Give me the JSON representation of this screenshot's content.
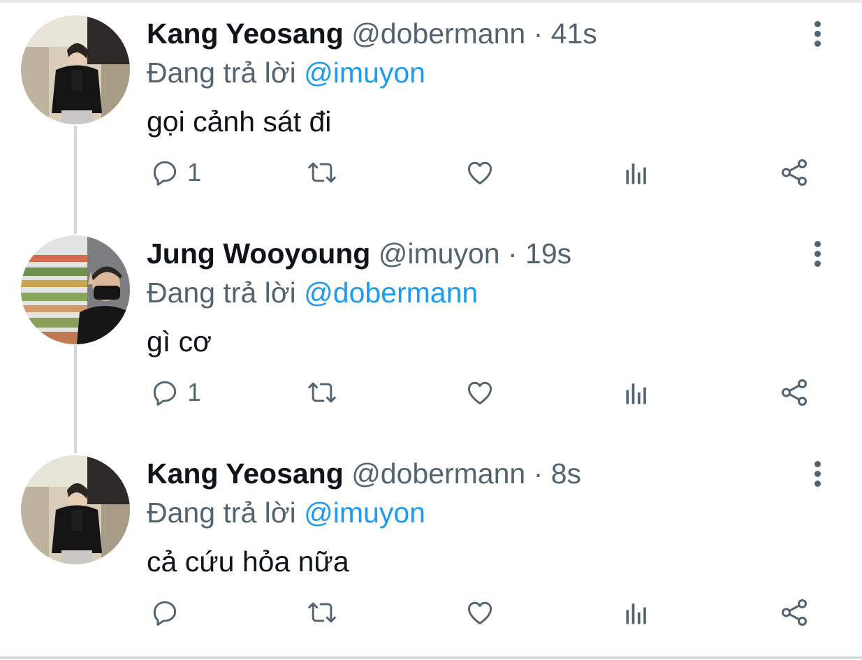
{
  "tweets": [
    {
      "name": "Kang Yeosang",
      "handle": "@dobermann",
      "separator": "·",
      "time": "41s",
      "replying_prefix": "Đang trả lời",
      "replying_to": "@imuyon",
      "text": "gọi cảnh sát đi",
      "reply_count": "1",
      "avatar": "profile-photo-man-black-shirt"
    },
    {
      "name": "Jung Wooyoung",
      "handle": "@imuyon",
      "separator": "·",
      "time": "19s",
      "replying_prefix": "Đang trả lời",
      "replying_to": "@dobermann",
      "text": "gì cơ",
      "reply_count": "1",
      "avatar": "profile-photo-man-mask-store"
    },
    {
      "name": "Kang Yeosang",
      "handle": "@dobermann",
      "separator": "·",
      "time": "8s",
      "replying_prefix": "Đang trả lời",
      "replying_to": "@imuyon",
      "text": "cả cứu hỏa nữa",
      "reply_count": "",
      "avatar": "profile-photo-man-black-shirt"
    }
  ],
  "icons": {
    "reply": "reply-icon",
    "retweet": "retweet-icon",
    "like": "heart-icon",
    "analytics": "analytics-icon",
    "share": "share-icon",
    "more": "more-vertical-icon"
  },
  "colors": {
    "link": "#1d9bf0",
    "secondary": "#536471",
    "primary_text": "#0f1419",
    "thread_line": "#cfd9de"
  }
}
